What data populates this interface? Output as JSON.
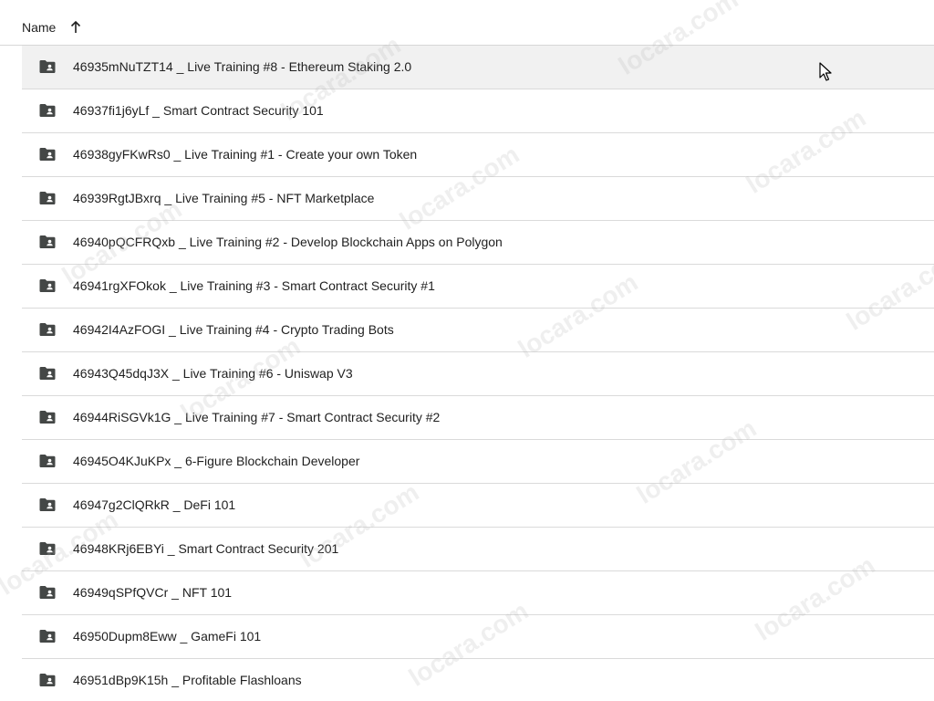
{
  "header": {
    "name_label": "Name",
    "sort_icon": "arrow-up-icon"
  },
  "rows": [
    {
      "label": "46935mNuTZT14 _ Live Training #8 - Ethereum Staking 2.0",
      "icon": "shared-folder-icon"
    },
    {
      "label": "46937fi1j6yLf _ Smart Contract Security 101",
      "icon": "shared-folder-icon"
    },
    {
      "label": "46938gyFKwRs0 _ Live Training #1 - Create your own Token",
      "icon": "shared-folder-icon"
    },
    {
      "label": "46939RgtJBxrq _ Live Training #5 - NFT Marketplace",
      "icon": "shared-folder-icon"
    },
    {
      "label": "46940pQCFRQxb _ Live Training #2 - Develop Blockchain Apps on Polygon",
      "icon": "shared-folder-icon"
    },
    {
      "label": "46941rgXFOkok _ Live Training #3 - Smart Contract Security #1",
      "icon": "shared-folder-icon"
    },
    {
      "label": "46942I4AzFOGI _ Live Training #4 - Crypto Trading Bots",
      "icon": "shared-folder-icon"
    },
    {
      "label": "46943Q45dqJ3X _ Live Training #6 - Uniswap V3",
      "icon": "shared-folder-icon"
    },
    {
      "label": "46944RiSGVk1G _ Live Training #7 - Smart Contract Security #2",
      "icon": "shared-folder-icon"
    },
    {
      "label": "46945O4KJuKPx _ 6-Figure Blockchain Developer",
      "icon": "shared-folder-icon"
    },
    {
      "label": "46947g2ClQRkR _ DeFi 101",
      "icon": "shared-folder-icon"
    },
    {
      "label": "46948KRj6EBYi _ Smart Contract Security 201",
      "icon": "shared-folder-icon"
    },
    {
      "label": "46949qSPfQVCr _ NFT 101",
      "icon": "shared-folder-icon"
    },
    {
      "label": "46950Dupm8Eww _ GameFi 101",
      "icon": "shared-folder-icon"
    },
    {
      "label": "46951dBp9K15h _ Profitable Flashloans",
      "icon": "shared-folder-icon"
    }
  ],
  "selected_row_index": 0,
  "watermark": "locara.com",
  "colors": {
    "selected_row_bg": "#f1f1f1",
    "text": "#1f1f1f",
    "icon": "#444746",
    "divider": "#dadada"
  }
}
